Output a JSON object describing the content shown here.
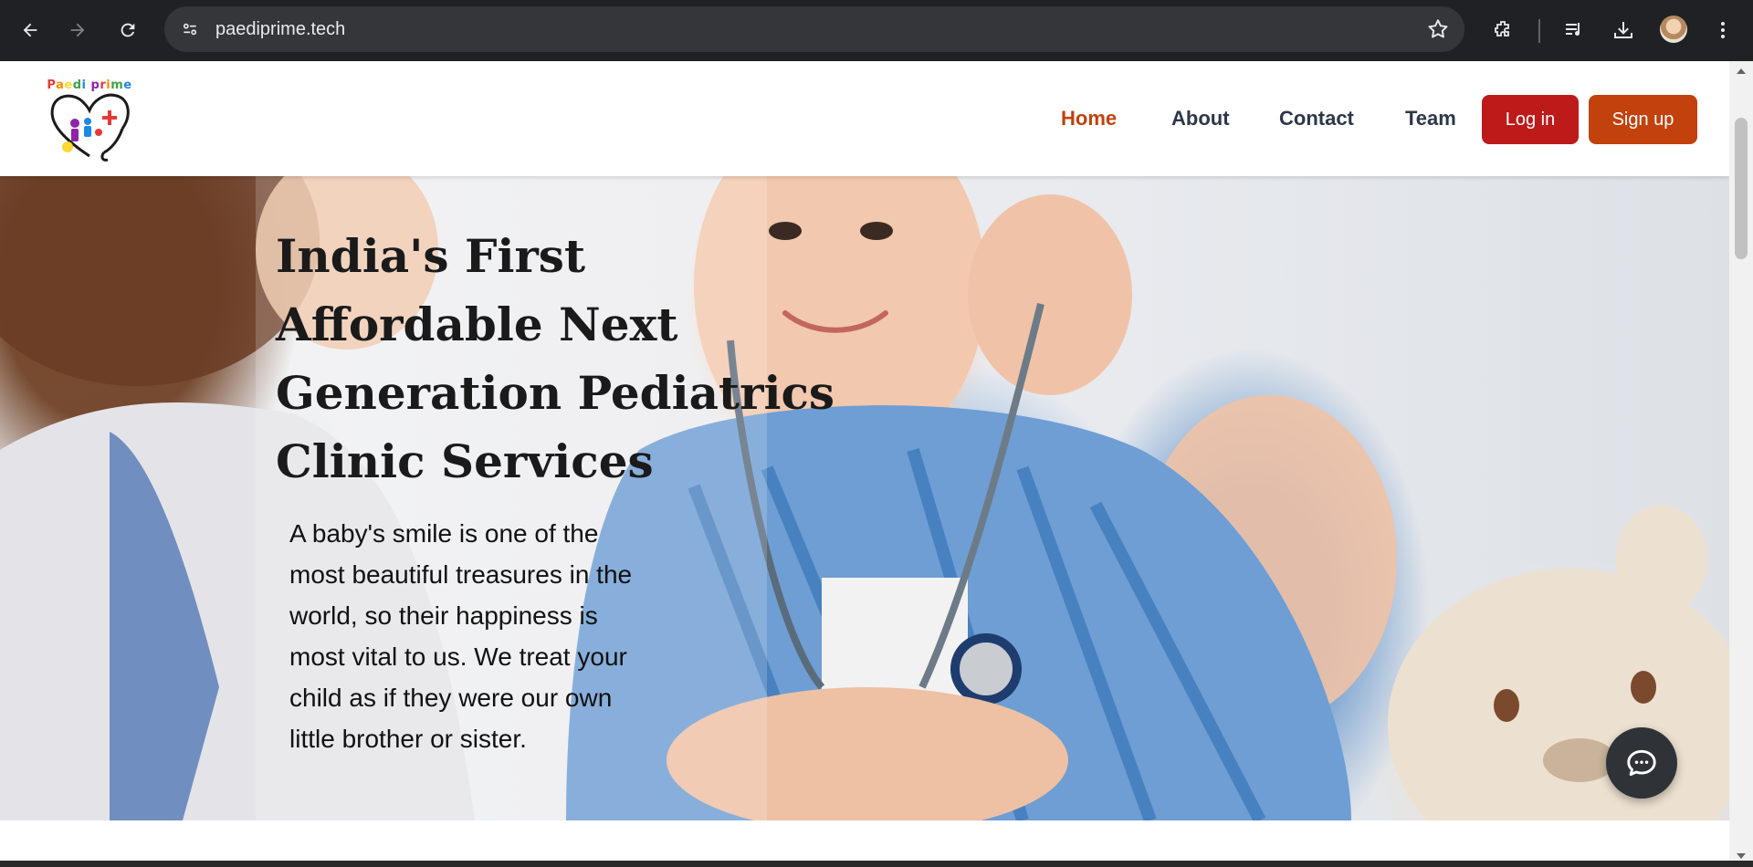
{
  "browser": {
    "url": "paediprime.tech"
  },
  "site": {
    "logo_text": "Paedi prime",
    "nav": {
      "home": "Home",
      "about": "About",
      "contact": "Contact",
      "team": "Team"
    },
    "login_label": "Log in",
    "signup_label": "Sign up"
  },
  "hero": {
    "title_lines": [
      "India's First",
      "Affordable Next",
      "Generation Pediatrics",
      "Clinic Services"
    ],
    "text": "A baby's smile is one of the most beautiful treasures in the world, so their happiness is most vital to us. We treat your child as if they were our own little brother or sister."
  },
  "colors": {
    "brand_orange": "#c2410c",
    "brand_red": "#be1a1a",
    "nav_text": "#2d3748"
  }
}
